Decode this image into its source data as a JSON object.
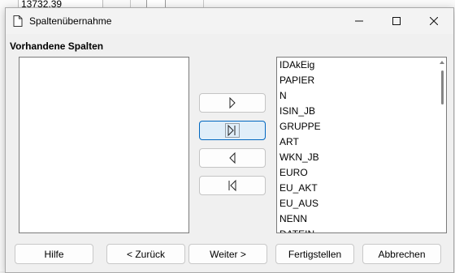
{
  "background": {
    "cell_value": "13732,39"
  },
  "dialog": {
    "title": "Spaltenübernahme",
    "section_label": "Vorhandene Spalten",
    "available_columns": [
      "IDAkEig",
      "PAPIER",
      "N",
      "ISIN_JB",
      "GRUPPE",
      "ART",
      "WKN_JB",
      "EURO",
      "EU_AKT",
      "EU_AUS",
      "NENN",
      "DATEIN"
    ],
    "selected_columns": [],
    "buttons": {
      "help": "Hilfe",
      "back": "< Zurück",
      "next": "Weiter >",
      "finish": "Fertigstellen",
      "cancel": "Abbrechen"
    },
    "move_buttons": [
      {
        "icon": "move-one-right-icon"
      },
      {
        "icon": "move-all-right-icon"
      },
      {
        "icon": "move-one-left-icon"
      },
      {
        "icon": "move-all-left-icon"
      }
    ],
    "accent_color": "#0067c0"
  }
}
